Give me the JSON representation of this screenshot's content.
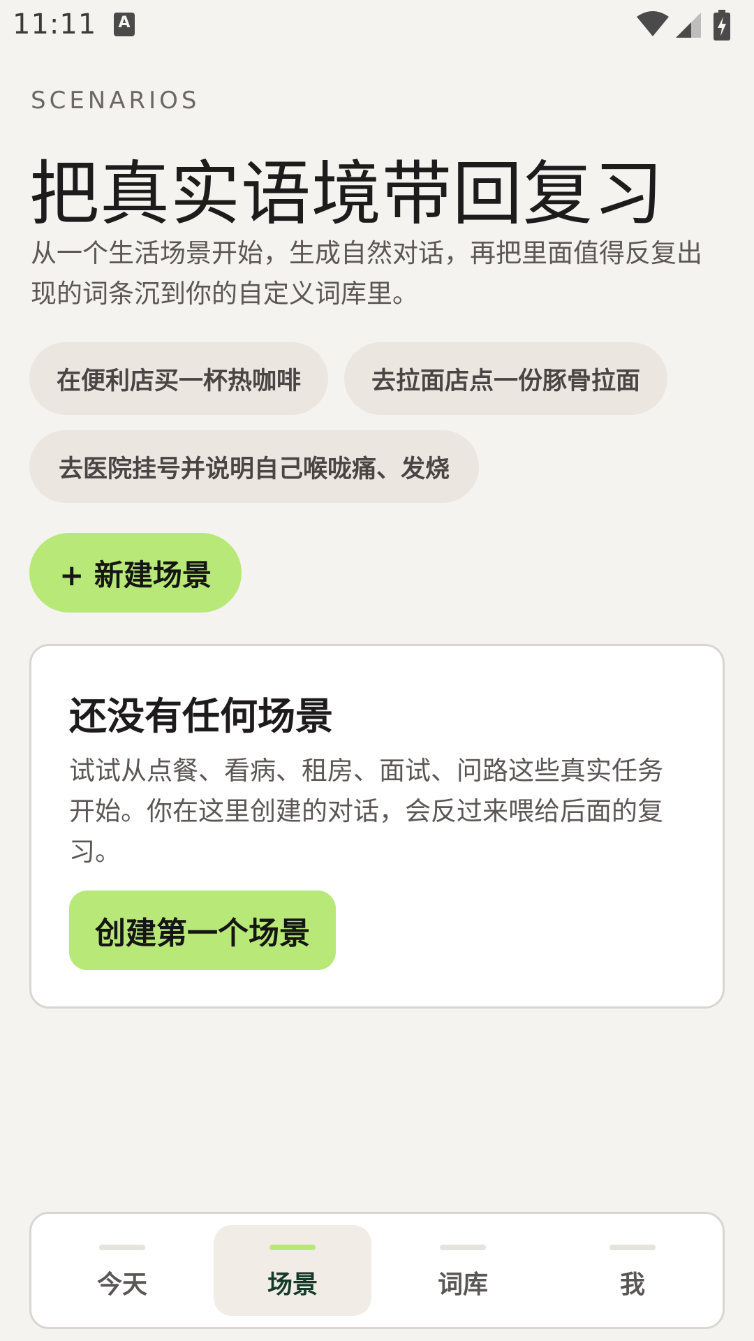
{
  "status_bar": {
    "time": "11:11",
    "notification_icon": "a-icon"
  },
  "header": {
    "eyebrow": "SCENARIOS",
    "title": "把真实语境带回复习",
    "description": "从一个生活场景开始，生成自然对话，再把里面值得反复出现的词条沉到你的自定义词库里。"
  },
  "chips": [
    {
      "label": "在便利店买一杯热咖啡"
    },
    {
      "label": "去拉面店点一份豚骨拉面"
    },
    {
      "label": "去医院挂号并说明自己喉咙痛、发烧"
    }
  ],
  "new_scene_button": {
    "label": "+ 新建场景"
  },
  "empty_state": {
    "title": "还没有任何场景",
    "description": "试试从点餐、看病、租房、面试、问路这些真实任务开始。你在这里创建的对话，会反过来喂给后面的复习。",
    "button_label": "创建第一个场景"
  },
  "bottom_nav": {
    "items": [
      {
        "label": "今天",
        "active": false
      },
      {
        "label": "场景",
        "active": true
      },
      {
        "label": "词库",
        "active": false
      },
      {
        "label": "我",
        "active": false
      }
    ]
  },
  "colors": {
    "background": "#F5F3EF",
    "accent": "#B8E878",
    "chip": "#EBE6DF",
    "card": "#FFFFFF"
  }
}
